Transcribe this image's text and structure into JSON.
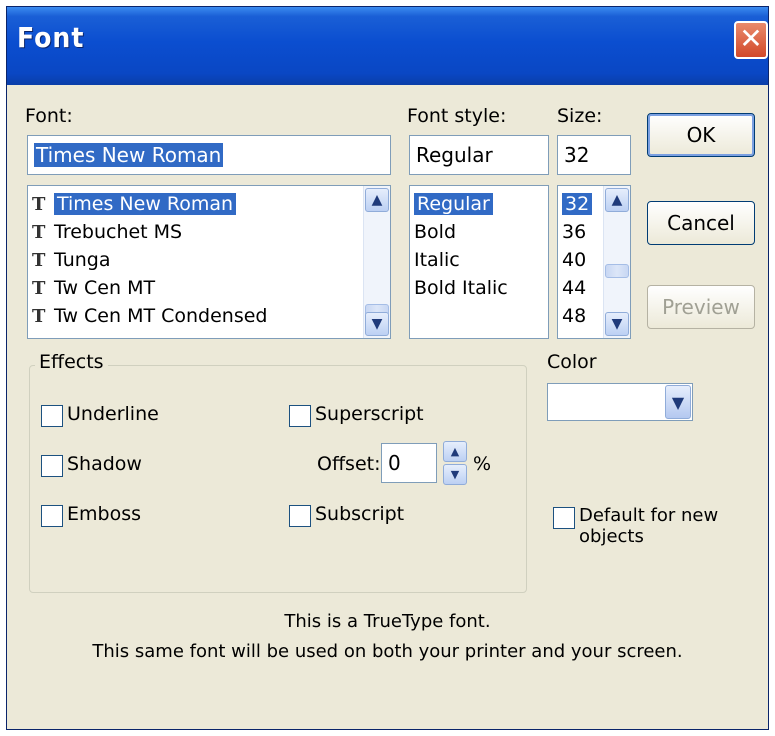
{
  "window": {
    "title": "Font",
    "close_glyph": "✕"
  },
  "font": {
    "label": "Font:",
    "value": "Times New Roman",
    "list": [
      "Times New Roman",
      "Trebuchet MS",
      "Tunga",
      "Tw Cen MT",
      "Tw Cen MT Condensed"
    ],
    "selected_index": 0
  },
  "font_style": {
    "label": "Font style:",
    "value": "Regular",
    "list": [
      "Regular",
      "Bold",
      "Italic",
      "Bold Italic"
    ],
    "selected_index": 0
  },
  "size": {
    "label": "Size:",
    "value": "32",
    "list": [
      "32",
      "36",
      "40",
      "44",
      "48"
    ],
    "selected_index": 0
  },
  "buttons": {
    "ok": "OK",
    "cancel": "Cancel",
    "preview": "Preview"
  },
  "effects": {
    "title": "Effects",
    "underline": "Underline",
    "shadow": "Shadow",
    "emboss": "Emboss",
    "superscript": "Superscript",
    "subscript": "Subscript",
    "offset_label": "Offset:",
    "offset_value": "0",
    "offset_unit": "%"
  },
  "color": {
    "label": "Color",
    "value": ""
  },
  "default_checkbox": "Default for new objects",
  "info": {
    "line1": "This is a TrueType font.",
    "line2": "This same font will be used on both your printer and your screen."
  },
  "icons": {
    "truetype": "T",
    "up": "▲",
    "down": "▼"
  },
  "colors": {
    "titlebar": "#0a47c4",
    "selection": "#316ac5",
    "dialog_bg": "#ece9d8",
    "close": "#d2492a"
  }
}
